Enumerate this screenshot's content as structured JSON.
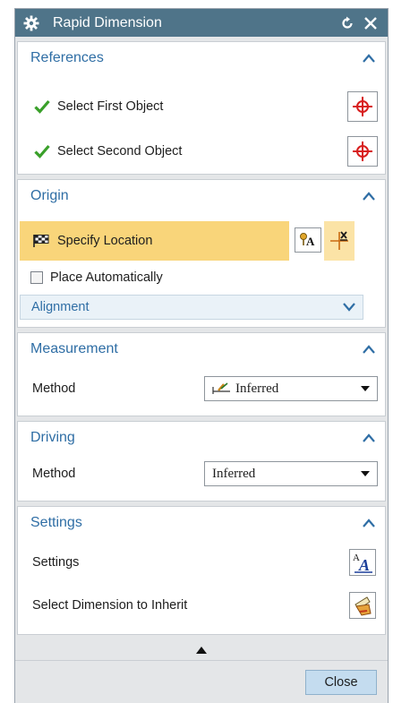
{
  "window": {
    "title": "Rapid Dimension",
    "reset_icon": "reset-icon",
    "close_icon": "close-icon"
  },
  "references": {
    "title": "References",
    "first_object": "Select First Object",
    "second_object": "Select Second Object"
  },
  "origin": {
    "title": "Origin",
    "specify_location": "Specify Location",
    "place_automatically": "Place Automatically",
    "place_automatically_checked": false,
    "alignment": "Alignment"
  },
  "measurement": {
    "title": "Measurement",
    "method_label": "Method",
    "method_value": "Inferred"
  },
  "driving": {
    "title": "Driving",
    "method_label": "Method",
    "method_value": "Inferred"
  },
  "settings": {
    "title": "Settings",
    "settings_label": "Settings",
    "inherit_label": "Select Dimension to Inherit"
  },
  "footer": {
    "close_label": "Close"
  },
  "colors": {
    "titlebar": "#4f7489",
    "section_title": "#2f6ea5",
    "highlight": "#f9d57a",
    "check_green": "#3aa02a",
    "crosshair_red": "#d81e1e",
    "close_button": "#c4dcef"
  }
}
